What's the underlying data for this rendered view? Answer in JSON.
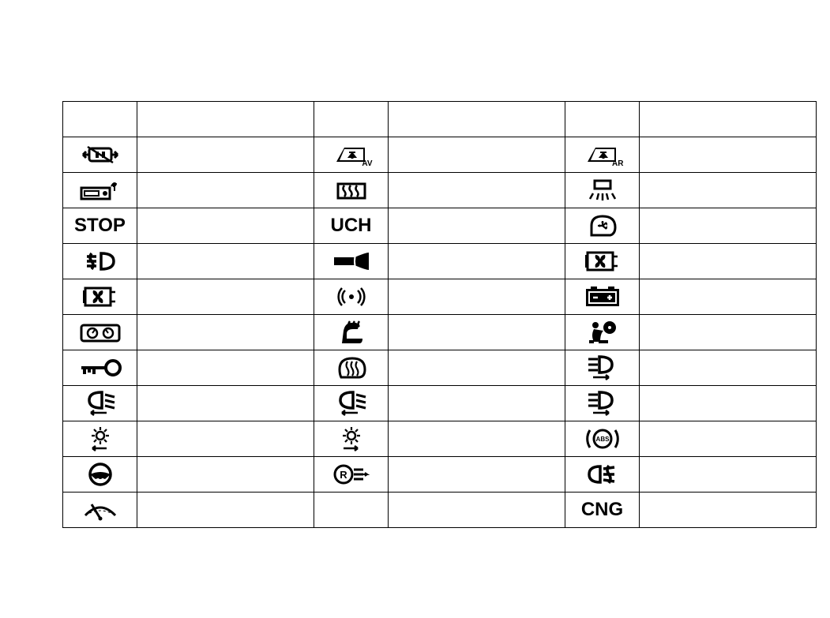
{
  "columns": 6,
  "rows": [
    {
      "a": {
        "type": "blank"
      },
      "b": {
        "type": "blank"
      },
      "c": {
        "type": "blank"
      }
    },
    {
      "a": {
        "type": "svg",
        "name": "hazard-lights-icon"
      },
      "b": {
        "type": "svg",
        "name": "power-window-front-icon",
        "sub": "AV"
      },
      "c": {
        "type": "svg",
        "name": "power-window-rear-icon",
        "sub": "AR"
      }
    },
    {
      "a": {
        "type": "svg",
        "name": "radio-audio-icon"
      },
      "b": {
        "type": "svg",
        "name": "rear-defrost-icon"
      },
      "c": {
        "type": "svg",
        "name": "interior-light-icon"
      }
    },
    {
      "a": {
        "type": "text",
        "name": "stop-warning-icon",
        "text": "STOP"
      },
      "b": {
        "type": "text",
        "name": "uch-module-icon",
        "text": "UCH"
      },
      "c": {
        "type": "svg",
        "name": "direction-indicator-icon"
      }
    },
    {
      "a": {
        "type": "svg",
        "name": "rear-fog-light-icon"
      },
      "b": {
        "type": "svg",
        "name": "horn-icon"
      },
      "c": {
        "type": "svg",
        "name": "fan-unit-icon"
      }
    },
    {
      "a": {
        "type": "svg",
        "name": "cooling-fan-module-icon"
      },
      "b": {
        "type": "svg",
        "name": "radio-signal-icon"
      },
      "c": {
        "type": "svg",
        "name": "battery-inverted-icon"
      }
    },
    {
      "a": {
        "type": "svg",
        "name": "instrument-cluster-icon"
      },
      "b": {
        "type": "svg",
        "name": "heated-seat-icon"
      },
      "c": {
        "type": "svg",
        "name": "airbag-icon"
      }
    },
    {
      "a": {
        "type": "svg",
        "name": "ignition-key-icon"
      },
      "b": {
        "type": "svg",
        "name": "heated-mirror-icon"
      },
      "c": {
        "type": "svg",
        "name": "high-beam-right-icon"
      }
    },
    {
      "a": {
        "type": "svg",
        "name": "low-beam-left-icon"
      },
      "b": {
        "type": "svg",
        "name": "low-beam-left-2-icon"
      },
      "c": {
        "type": "svg",
        "name": "high-beam-right-2-icon"
      }
    },
    {
      "a": {
        "type": "svg",
        "name": "running-light-left-icon"
      },
      "b": {
        "type": "svg",
        "name": "running-light-right-icon"
      },
      "c": {
        "type": "svg",
        "name": "abs-brake-icon",
        "text": "ABS"
      }
    },
    {
      "a": {
        "type": "svg",
        "name": "steering-wheel-icon"
      },
      "b": {
        "type": "svg",
        "name": "reverse-light-icon",
        "text": "R"
      },
      "c": {
        "type": "svg",
        "name": "front-fog-light-icon"
      }
    },
    {
      "a": {
        "type": "svg",
        "name": "windscreen-wiper-icon"
      },
      "b": {
        "type": "blank"
      },
      "c": {
        "type": "text",
        "name": "cng-fuel-icon",
        "text": "CNG"
      }
    }
  ]
}
